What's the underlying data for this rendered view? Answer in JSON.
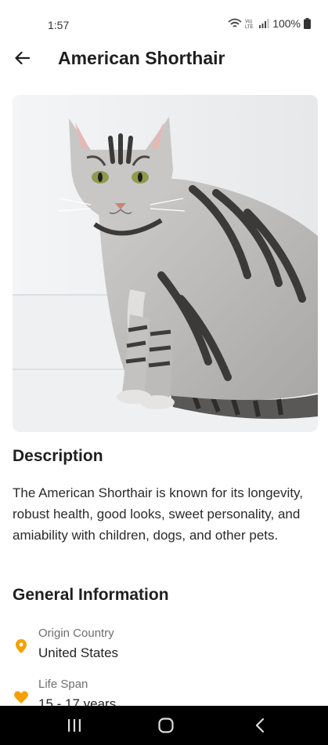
{
  "status_bar": {
    "time": "1:57",
    "battery": "100%",
    "network_label": "Vo) LTE"
  },
  "header": {
    "title": "American Shorthair",
    "back_icon": "arrow-left-icon"
  },
  "hero_image": {
    "subject": "silver tabby cat",
    "bg_color": "#eceef0"
  },
  "description": {
    "heading": "Description",
    "text": "The American Shorthair is known for its longevity, robust health, good looks, sweet personality, and amiability with children, dogs, and other pets."
  },
  "general_info": {
    "heading": "General Information",
    "items": [
      {
        "icon": "location-pin-icon",
        "label": "Origin Country",
        "value": "United States"
      },
      {
        "icon": "heart-icon",
        "label": "Life Span",
        "value": "15 - 17 years"
      }
    ],
    "accent_color": "#f5a000"
  },
  "nav_bar": {
    "recents_icon": "recents-icon",
    "home_icon": "home-icon",
    "back_icon": "back-chevron-icon"
  }
}
